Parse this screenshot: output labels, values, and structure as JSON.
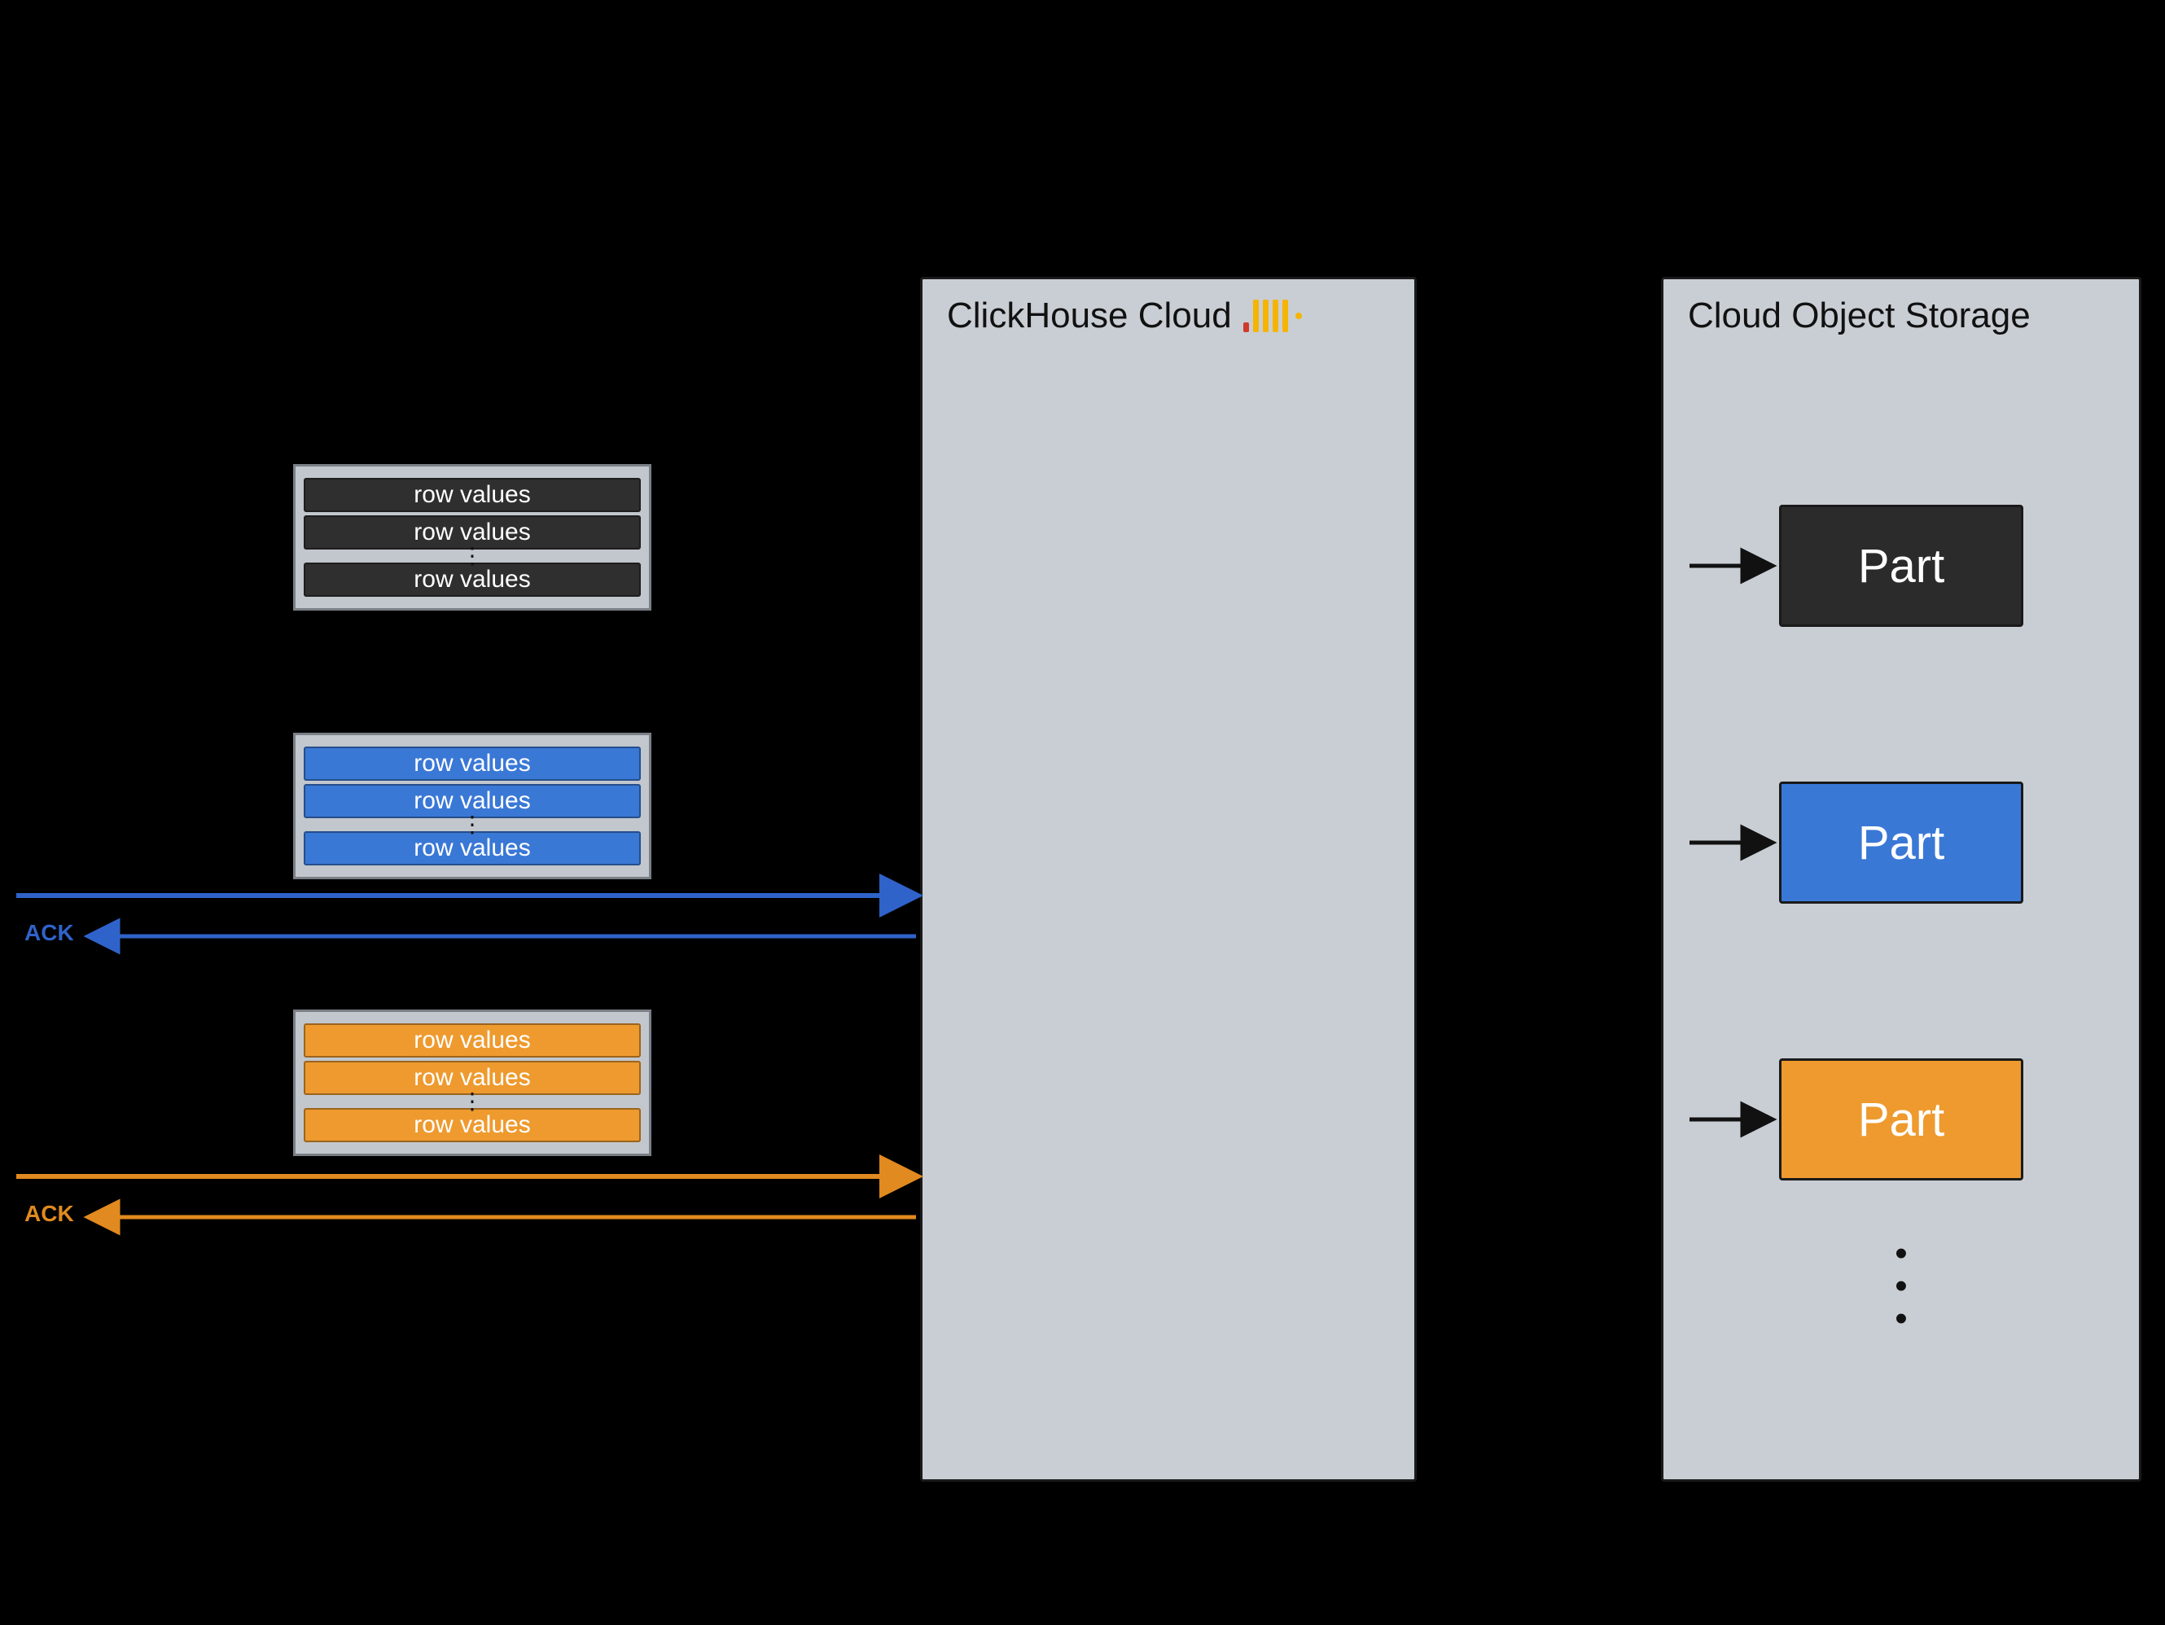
{
  "panels": {
    "clickhouse_title": "ClickHouse Cloud",
    "storage_title": "Cloud Object Storage"
  },
  "row_label": "row values",
  "ack_label": "ACK",
  "part_label": "Part",
  "colors": {
    "dark": "#2f2f2f",
    "blue": "#3a78d6",
    "orange": "#ee9a2e",
    "panel_bg": "#c9ced4"
  },
  "blocks": [
    {
      "color": "dark",
      "rows": 3
    },
    {
      "color": "blue",
      "rows": 3
    },
    {
      "color": "orange",
      "rows": 3
    }
  ],
  "parts": [
    {
      "color": "dark"
    },
    {
      "color": "blue"
    },
    {
      "color": "orange"
    }
  ]
}
